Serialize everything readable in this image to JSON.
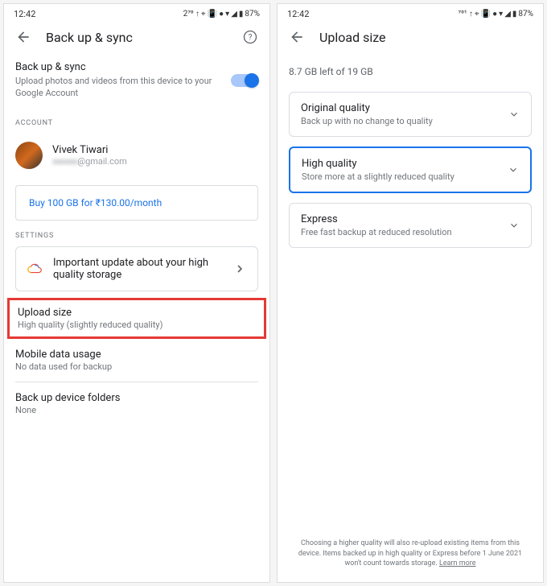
{
  "status": {
    "time": "12:42",
    "net_left": "2⁷⁰ ↑",
    "net_right": "⁷⁰¹ ↑",
    "batt": "87%"
  },
  "left": {
    "title": "Back up & sync",
    "sync": {
      "title": "Back up & sync",
      "sub": "Upload photos and videos from this device to your Google Account"
    },
    "account_label": "ACCOUNT",
    "account": {
      "name": "Vivek Tiwari",
      "email_suffix": "@gmail.com"
    },
    "buy": "Buy 100 GB for ₹130.00/month",
    "settings_label": "SETTINGS",
    "update": "Important update about your high quality storage",
    "upload": {
      "title": "Upload size",
      "sub": "High quality (slightly reduced quality)"
    },
    "mobile": {
      "title": "Mobile data usage",
      "sub": "No data used for backup"
    },
    "folders": {
      "title": "Back up device folders",
      "sub": "None"
    }
  },
  "right": {
    "title": "Upload size",
    "storage": "8.7 GB left of 19 GB",
    "options": [
      {
        "title": "Original quality",
        "sub": "Back up with no change to quality"
      },
      {
        "title": "High quality",
        "sub": "Store more at a slightly reduced quality"
      },
      {
        "title": "Express",
        "sub": "Free fast backup at reduced resolution"
      }
    ],
    "footer": "Choosing a higher quality will also re-upload existing items from this device. Items backed up in high quality or Express before 1 June 2021 won't count towards storage.",
    "learn": "Learn more"
  }
}
